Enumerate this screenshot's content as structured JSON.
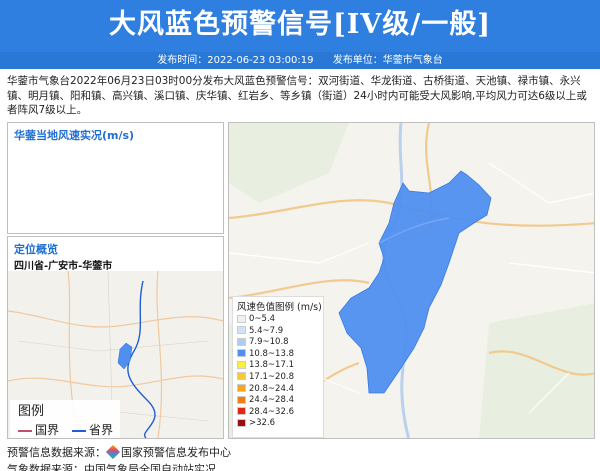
{
  "header": {
    "title": "大风蓝色预警信号[IV级/一般]",
    "publish_time_label": "发布时间：2022-06-23 03:00:19",
    "publisher_label": "发布单位：华蓥市气象台"
  },
  "description": "华蓥市气象台2022年06月23日03时00分发布大风蓝色预警信号：双河街道、华龙街道、古桥街道、天池镇、禄市镇、永兴镇、明月镇、阳和镇、高兴镇、溪口镇、庆华镇、红岩乡、等乡镇（街道）24小时内可能受大风影响,平均风力可达6级以上或者阵风7级以上。",
  "wind_panel": {
    "title": "华蓥当地风速实况(m/s)"
  },
  "location_panel": {
    "title": "定位概览",
    "location": "四川省-广安市-华蓥市",
    "legend": {
      "title": "图例",
      "items": [
        {
          "label": "国界",
          "color": "#c0506e"
        },
        {
          "label": "省界",
          "color": "#1f5ed4"
        }
      ]
    }
  },
  "map_legend": {
    "title": "风速色值图例 (m/s)",
    "items": [
      {
        "label": "0~5.4",
        "color": "#f0f0f0"
      },
      {
        "label": "5.4~7.9",
        "color": "#cfe2f7"
      },
      {
        "label": "7.9~10.8",
        "color": "#a9cdf4"
      },
      {
        "label": "10.8~13.8",
        "color": "#4f8ff0"
      },
      {
        "label": "13.8~17.1",
        "color": "#f8f03a"
      },
      {
        "label": "17.1~20.8",
        "color": "#f6c93a"
      },
      {
        "label": "20.8~24.4",
        "color": "#f6a623"
      },
      {
        "label": "24.4~28.4",
        "color": "#f07d1c"
      },
      {
        "label": "28.4~32.6",
        "color": "#e0251b"
      },
      {
        "label": ">32.6",
        "color": "#9a1010"
      }
    ]
  },
  "footer": {
    "source_label": "预警信息数据来源：",
    "source_name": "国家预警信息发布中心",
    "line2": "气象数据来源：中国气象局全国自动站实况"
  }
}
